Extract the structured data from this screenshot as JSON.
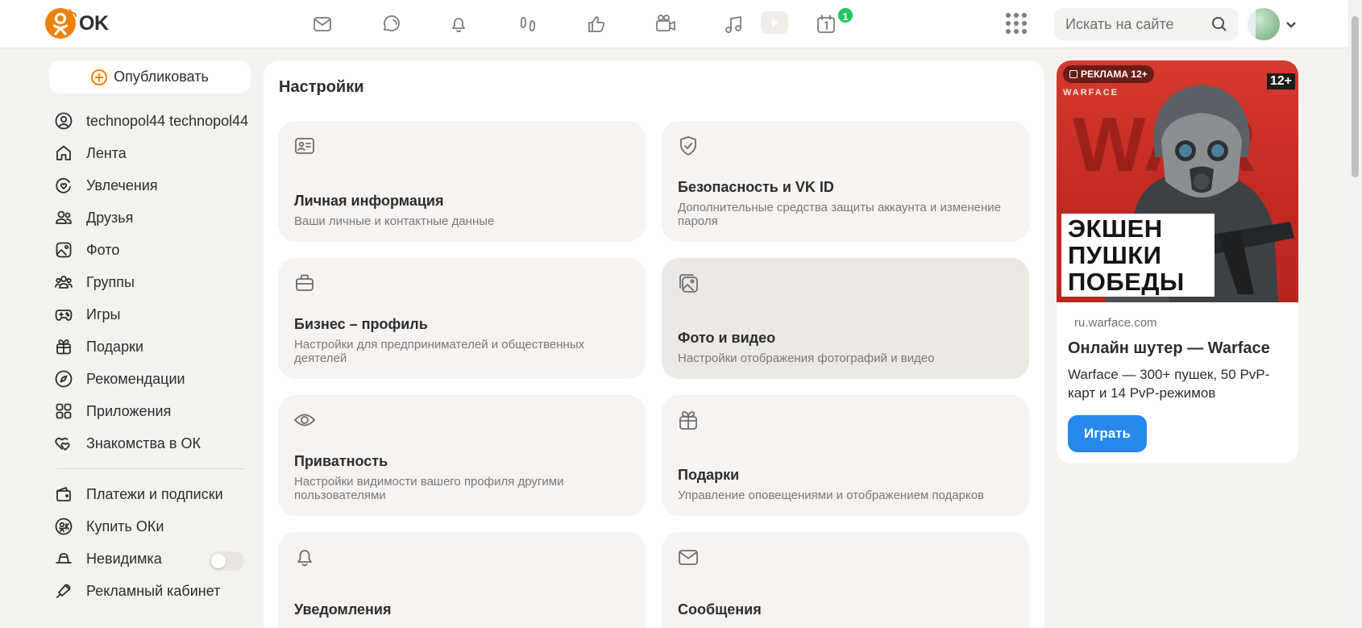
{
  "header": {
    "logo_text": "OK",
    "search_placeholder": "Искать на сайте",
    "notification_count": "1",
    "nav_icons": [
      "mail-icon",
      "discussions-icon",
      "bell-icon",
      "guests-icon",
      "like-icon",
      "video-camera-icon",
      "music-icon",
      "video-play-icon",
      "calendar-icon"
    ]
  },
  "sidebar": {
    "publish_label": "Опубликовать",
    "items": [
      {
        "label": "technopol44 technopol44",
        "icon": "profile-icon"
      },
      {
        "label": "Лента",
        "icon": "home-icon"
      },
      {
        "label": "Увлечения",
        "icon": "hobby-icon"
      },
      {
        "label": "Друзья",
        "icon": "friends-icon"
      },
      {
        "label": "Фото",
        "icon": "photo-icon"
      },
      {
        "label": "Группы",
        "icon": "groups-icon"
      },
      {
        "label": "Игры",
        "icon": "gamepad-icon"
      },
      {
        "label": "Подарки",
        "icon": "gift-icon"
      },
      {
        "label": "Рекомендации",
        "icon": "compass-icon"
      },
      {
        "label": "Приложения",
        "icon": "apps-icon"
      },
      {
        "label": "Знакомства в ОК",
        "icon": "hearts-icon"
      }
    ],
    "bottom_items": [
      {
        "label": "Платежи и подписки",
        "icon": "wallet-icon"
      },
      {
        "label": "Купить ОКи",
        "icon": "coin-icon"
      },
      {
        "label": "Невидимка",
        "icon": "invisible-icon",
        "toggle": false
      },
      {
        "label": "Рекламный кабинет",
        "icon": "megaphone-icon"
      }
    ]
  },
  "settings": {
    "title": "Настройки",
    "cards": [
      {
        "title": "Личная информация",
        "description": "Ваши личные и контактные данные",
        "icon": "id-card-icon"
      },
      {
        "title": "Безопасность и VK ID",
        "description": "Дополнительные средства защиты аккаунта и изменение пароля",
        "icon": "shield-check-icon"
      },
      {
        "title": "Бизнес – профиль",
        "description": "Настройки для предпринимателей и общественных деятелей",
        "icon": "briefcase-icon"
      },
      {
        "title": "Фото и видео",
        "description": "Настройки отображения фотографий и видео",
        "icon": "gallery-icon"
      },
      {
        "title": "Приватность",
        "description": "Настройки видимости вашего профиля другими пользователями",
        "icon": "eye-icon"
      },
      {
        "title": "Подарки",
        "description": "Управление оповещениями и отображением подарков",
        "icon": "gift-icon"
      },
      {
        "title": "Уведомления",
        "description": "",
        "icon": "bell-icon"
      },
      {
        "title": "Сообщения",
        "description": "",
        "icon": "mail-icon"
      }
    ]
  },
  "ad": {
    "badge": "РЕКЛАМА 12+",
    "brand": "WARFACE",
    "age": "12+",
    "slogan": "ЭКШЕН ПУШКИ ПОБЕДЫ",
    "domain": "ru.warface.com",
    "title": "Онлайн шутер — Warface",
    "text": "Warface — 300+ пушек, 50 PvP-карт и 14 PvP-режимов",
    "button": "Играть"
  },
  "colors": {
    "brand_orange": "#ee8208",
    "accent_blue": "#2688eb",
    "badge_green": "#22c55e",
    "page_bg": "#f4f2ef",
    "card_bg": "#f6f3f0"
  }
}
